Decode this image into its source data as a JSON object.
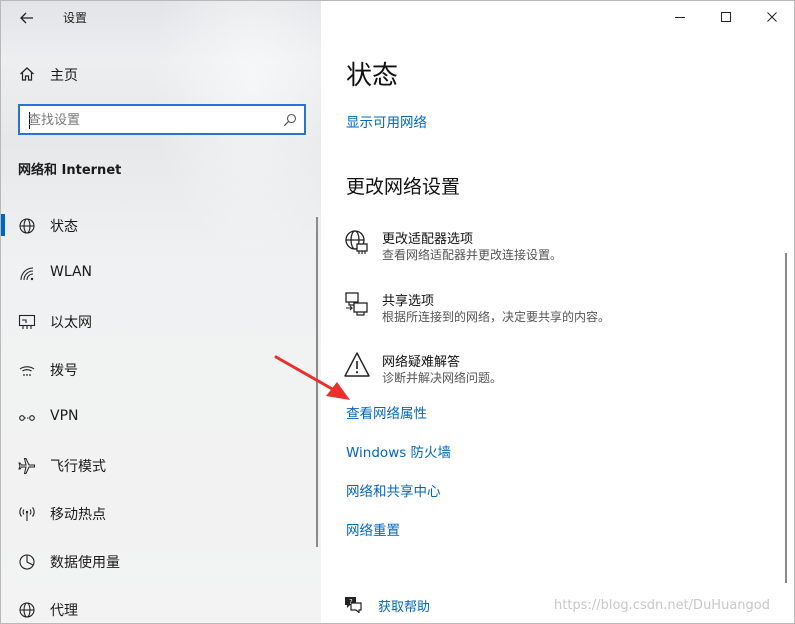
{
  "window": {
    "title": "设置",
    "back_icon": "arrow-left-icon",
    "controls": {
      "minimize_icon": "minimize-icon",
      "maximize_icon": "maximize-icon",
      "close_icon": "close-icon"
    }
  },
  "sidebar": {
    "home_label": "主页",
    "home_icon": "home-icon",
    "search": {
      "placeholder": "查找设置",
      "value": "",
      "icon": "search-icon"
    },
    "section_heading": "网络和 Internet",
    "items": [
      {
        "label": "状态",
        "icon": "globe-icon",
        "active": true
      },
      {
        "label": "WLAN",
        "icon": "wifi-icon",
        "active": false
      },
      {
        "label": "以太网",
        "icon": "ethernet-icon",
        "active": false
      },
      {
        "label": "拨号",
        "icon": "dialup-icon",
        "active": false
      },
      {
        "label": "VPN",
        "icon": "vpn-icon",
        "active": false
      },
      {
        "label": "飞行模式",
        "icon": "airplane-icon",
        "active": false
      },
      {
        "label": "移动热点",
        "icon": "hotspot-icon",
        "active": false
      },
      {
        "label": "数据使用量",
        "icon": "data-usage-icon",
        "active": false
      },
      {
        "label": "代理",
        "icon": "globe-icon",
        "active": false
      }
    ]
  },
  "main": {
    "page_title": "状态",
    "show_networks_link": "显示可用网络",
    "change_heading": "更改网络设置",
    "options": [
      {
        "title": "更改适配器选项",
        "desc": "查看网络适配器并更改连接设置。",
        "icon": "adapter-icon"
      },
      {
        "title": "共享选项",
        "desc": "根据所连接到的网络，决定要共享的内容。",
        "icon": "sharing-icon"
      },
      {
        "title": "网络疑难解答",
        "desc": "诊断并解决网络问题。",
        "icon": "warning-icon"
      }
    ],
    "links": [
      "查看网络属性",
      "Windows 防火墙",
      "网络和共享中心",
      "网络重置"
    ],
    "help_label": "获取帮助",
    "help_icon": "help-chat-icon"
  },
  "overlay": {
    "watermark": "https://blog.csdn.net/DuHuangod",
    "arrow_color": "#e8312b"
  },
  "colors": {
    "accent": "#0067c0",
    "search_border": "#2673d9"
  }
}
